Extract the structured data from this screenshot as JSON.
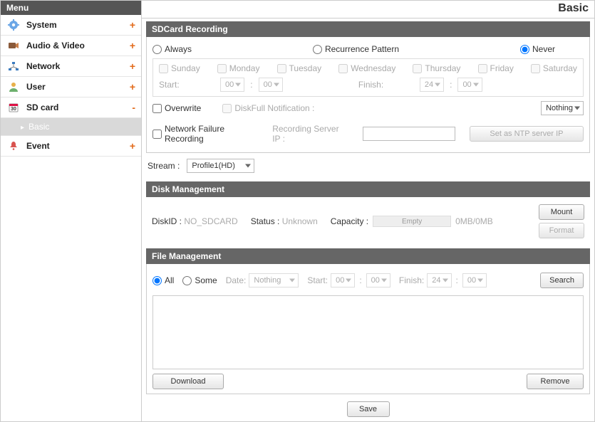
{
  "sidebar": {
    "header": "Menu",
    "items": [
      {
        "label": "System",
        "expand": "+"
      },
      {
        "label": "Audio & Video",
        "expand": "+"
      },
      {
        "label": "Network",
        "expand": "+"
      },
      {
        "label": "User",
        "expand": "+"
      },
      {
        "label": "SD card",
        "expand": "-",
        "sub": [
          {
            "label": "Basic"
          }
        ]
      },
      {
        "label": "Event",
        "expand": "+"
      }
    ],
    "sub_triangle": "▸"
  },
  "page": {
    "title": "Basic"
  },
  "sd": {
    "header": "SDCard Recording",
    "mode": {
      "always": "Always",
      "recurrence": "Recurrence Pattern",
      "never": "Never"
    },
    "days": {
      "sunday": "Sunday",
      "monday": "Monday",
      "tuesday": "Tuesday",
      "wednesday": "Wednesday",
      "thursday": "Thursday",
      "friday": "Friday",
      "saturday": "Saturday"
    },
    "time": {
      "start_label": "Start:",
      "finish_label": "Finish:",
      "start_h": "00",
      "start_m": "00",
      "finish_h": "24",
      "finish_m": "00"
    },
    "overwrite_label": "Overwrite",
    "diskfull_label": "DiskFull Notification :",
    "diskfull_value": "Nothing",
    "nf_label": "Network Failure Recording",
    "server_ip_label": "Recording Server IP :",
    "ntp_btn": "Set as NTP server IP",
    "stream_label": "Stream :",
    "stream_value": "Profile1(HD)"
  },
  "disk": {
    "header": "Disk Management",
    "id_label": "DiskID :",
    "id_value": "NO_SDCARD",
    "status_label": "Status :",
    "status_value": "Unknown",
    "capacity_label": "Capacity :",
    "progress_text": "Empty",
    "capacity_value": "0MB/0MB",
    "mount_btn": "Mount",
    "format_btn": "Format"
  },
  "file": {
    "header": "File Management",
    "all": "All",
    "some": "Some",
    "date_label": "Date:",
    "date_value": "Nothing",
    "start_label": "Start:",
    "finish_label": "Finish:",
    "start_h": "00",
    "start_m": "00",
    "finish_h": "24",
    "finish_m": "00",
    "search_btn": "Search",
    "download_btn": "Download",
    "remove_btn": "Remove"
  },
  "save_btn": "Save"
}
